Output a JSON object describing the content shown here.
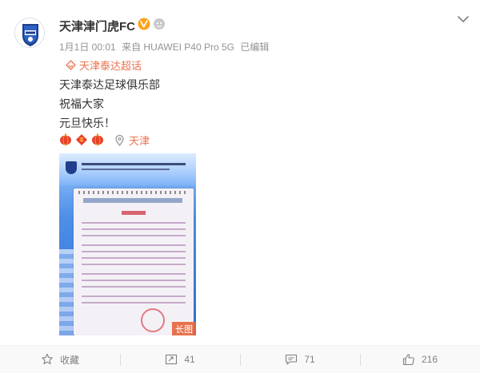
{
  "post": {
    "user_name": "天津津门虎FC",
    "meta": {
      "date": "1月1日 00:01",
      "source": "来自 HUAWEI P40 Pro 5G",
      "edited": "已编辑"
    },
    "supertopic": "天津泰达超话",
    "lines": [
      "天津泰达足球俱乐部",
      "祝福大家",
      "元旦快乐！"
    ],
    "location": "天津",
    "image_badge": "长图"
  },
  "actions": {
    "favorite": "收藏",
    "repost": "41",
    "comment": "71",
    "like": "216"
  },
  "colors": {
    "accent": "#eb7350",
    "verified": "#ffa21a",
    "muted": "#939393"
  },
  "icons": {
    "verified": "verified-v-icon",
    "member": "member-badge-icon",
    "dropdown": "chevron-down-icon",
    "supertopic": "supertopic-diamond-icon",
    "location": "location-pin-icon",
    "favorite": "star-icon",
    "repost": "repost-icon",
    "comment": "comment-icon",
    "like": "thumbs-up-icon"
  }
}
